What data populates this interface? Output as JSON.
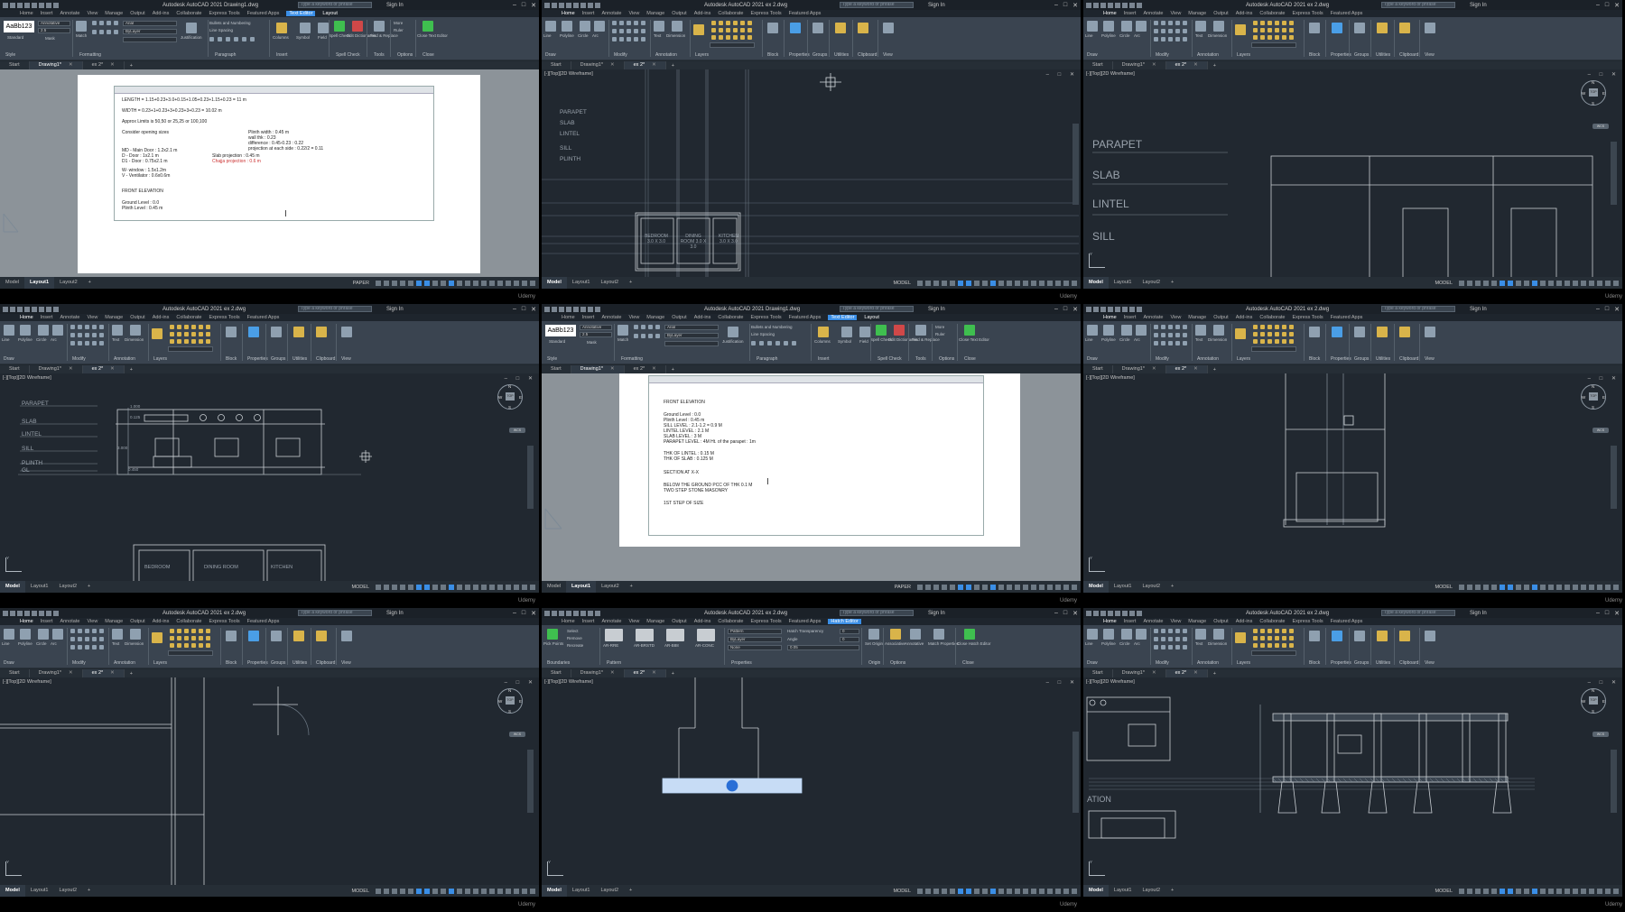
{
  "app": {
    "title_ex2": "Autodesk AutoCAD 2021    ex 2.dwg",
    "title_d1": "Autodesk AutoCAD 2021    Drawing1.dwg",
    "search_placeholder": "Type a keyword or phrase",
    "sign_in": "Sign In",
    "watermark": "Udemy"
  },
  "menu": {
    "items": [
      "Home",
      "Insert",
      "Annotate",
      "View",
      "Manage",
      "Output",
      "Add-ins",
      "Collaborate",
      "Express Tools",
      "Featured Apps"
    ],
    "text_editor": "Text Editor",
    "layout": "Layout",
    "hatch_editor": "Hatch Editor"
  },
  "ribbon_home": {
    "groups": [
      "Draw",
      "Modify",
      "Annotation",
      "Layers",
      "Block",
      "Properties",
      "Groups",
      "Utilities",
      "Clipboard",
      "View"
    ],
    "tools": [
      "Line",
      "Polyline",
      "Circle",
      "Arc",
      "Text",
      "Dimension",
      "Layer Properties",
      "Insert",
      "Properties",
      "Groups",
      "Utilities",
      "Clipboard",
      "Base"
    ]
  },
  "ribbon_text": {
    "groups": [
      "Style",
      "Formatting",
      "Paragraph",
      "Insert",
      "Spell Check",
      "Tools",
      "Options",
      "Close"
    ],
    "style_sample": "AaBb123",
    "style_name": "Standard",
    "annotative": "Annotative",
    "font": "Arial",
    "color": "ByLayer",
    "height": "2.5",
    "mask": "Mask",
    "match": "Match",
    "justification": "Justification",
    "bullets": "Bullets and Numbering",
    "line_spacing": "Line Spacing",
    "columns": "Columns",
    "symbol": "Symbol",
    "field": "Field",
    "spell": "Spell Check",
    "edit_dict": "Edit Dictionaries",
    "find": "Find & Replace",
    "more": "More",
    "ruler": "Ruler",
    "close": "Close Text Editor"
  },
  "ribbon_hatch": {
    "groups": [
      "Boundaries",
      "Pattern",
      "Properties",
      "Origin",
      "Options",
      "Close"
    ],
    "pick_points": "Pick Points",
    "select": "Select",
    "remove": "Remove",
    "recreate": "Recreate",
    "patterns": [
      "AR-RRE",
      "AR-BRSTD",
      "AR-B88",
      "AR-CONC"
    ],
    "pattern_type": "Pattern",
    "transparency": "Hatch Transparency",
    "transparency_val": "0",
    "angle": "Angle",
    "angle_val": "0",
    "scale_val": "0.05",
    "color": "ByLayer",
    "bg": "None",
    "set_origin": "Set Origin",
    "associative": "Associative",
    "annotative": "Annotative",
    "match": "Match Properties",
    "close": "Close Hatch Editor"
  },
  "file_tabs": [
    "Start",
    "Drawing1*",
    "ex 2*"
  ],
  "layout_tabs": [
    "Model",
    "Layout1",
    "Layout2"
  ],
  "status": {
    "model": "MODEL",
    "paper": "PAPER"
  },
  "viewport_label": "[-][Top][2D Wireframe]",
  "viewcube": {
    "top": "TOP",
    "n": "N",
    "s": "S",
    "e": "E",
    "w": "W",
    "wcs": "WCS"
  },
  "p1_text": [
    "LENGTH = 1.15+0.23+3.0+0.15+1.05+0.23+1.15+0.23 = 11 m",
    "WIDTH = 0.23+1+0.23+3+0.23+3+0.23 = 10.02 m",
    "Approx Limits is 50,50 or 25,25 or 100,100",
    "Consider opening sizes",
    "MD - Main Door : 1.2x2.1 m",
    "D - Door : 1x2.1 m",
    "D1 - Door : 0.75x2.1 m",
    "W- window : 1.5x1.2m",
    "V - Ventilator : 0.6x0.6m",
    "FRONT ELEVATION",
    "Ground Level : 0.0",
    "Plinth Level : 0.45 m",
    "Plinth width : 0.45 m",
    "wall thk : 0.23",
    "difference : 0.45-0.23 : 0.22",
    "projection at each side : 0.22/2 = 0.11",
    "Slab projection : 0.45 m",
    "Chajja projection : 0.6 m"
  ],
  "p2_labels": [
    "PARAPET",
    "SLAB",
    "LINTEL",
    "SILL",
    "PLINTH"
  ],
  "p2_rooms": [
    "BEDROOM 3.0 X 3.0",
    "DINING ROOM 3.0 X 3.0",
    "KITCHEN 3.0 X 3.0"
  ],
  "p3_labels": [
    "PARAPET",
    "SLAB",
    "LINTEL",
    "SILL"
  ],
  "p4_labels": [
    "PARAPET",
    "SLAB",
    "LINTEL",
    "SILL",
    "PLINTH",
    "GL"
  ],
  "p4_rooms": [
    "BEDROOM",
    "DINING ROOM",
    "KITCHEN"
  ],
  "p4_dims": [
    "1.000",
    "0.125",
    "3.000",
    "0.450"
  ],
  "p5_text": [
    "FRONT ELEVATION",
    "Ground Level : 0.0",
    "Plinth Level : 0.45 m",
    "SILL LEVEL : 2.1-1.2 = 0.9 M",
    "LINTEL LEVEL : 2.1 M",
    "SLAB LEVEL : 3 M",
    "PARAPET LEVEL : 4M    Ht. of the parapet : 1m",
    "THK OF LINTEL : 0.15 M",
    "THK OF SLAB : 0.125 M",
    "SECTION AT X-X",
    "BELOW THE GROUND PCC OF THK 0.1 M",
    "TWO STEP STONE MASONRY",
    "1ST STEP OF SIZE"
  ],
  "p9_label": "ATION"
}
